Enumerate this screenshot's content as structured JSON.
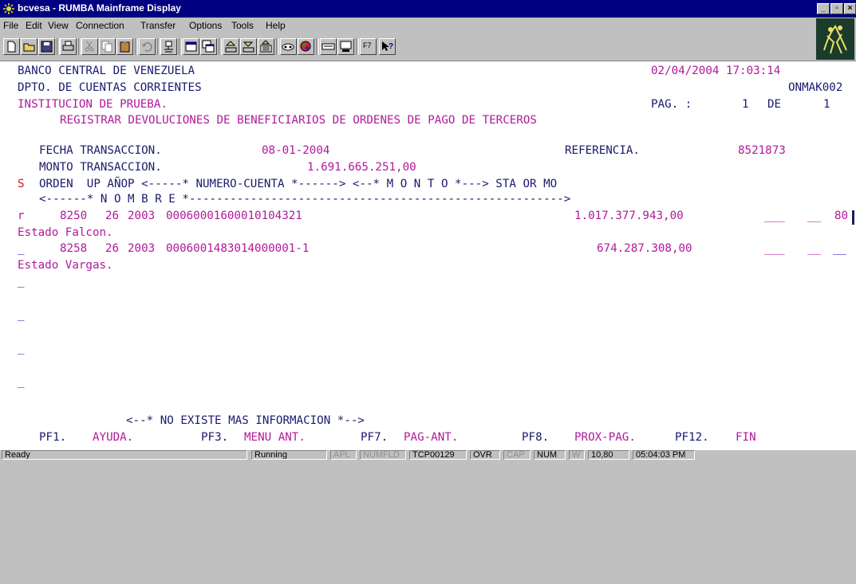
{
  "window": {
    "title": "bcvesa - RUMBA Mainframe Display",
    "controls": [
      "_",
      "▫",
      "×"
    ]
  },
  "menu": [
    "File",
    "Edit",
    "View",
    "Connection",
    "Transfer",
    "Options",
    "Tools",
    "Help"
  ],
  "toolbar": {
    "f7_label": "F7"
  },
  "screen": {
    "header": {
      "bank": "BANCO CENTRAL DE VENEZUELA",
      "datetime": "02/04/2004 17:03:14",
      "dept": "DPTO. DE CUENTAS CORRIENTES",
      "program": "ONMAK002",
      "institution": "INSTITUCION DE PRUEBA.",
      "page_label": "PAG. :",
      "page_num": "1",
      "page_of": "DE",
      "page_total": "1",
      "title": "REGISTRAR DEVOLUCIONES DE BENEFICIARIOS DE ORDENES DE PAGO DE TERCEROS"
    },
    "fields": {
      "fecha_label": "FECHA TRANSACCION.",
      "fecha_value": "08-01-2004",
      "ref_label": "REFERENCIA.",
      "ref_value": "8521873",
      "monto_label": "MONTO TRANSACCION.",
      "monto_value": "1.691.665.251,00"
    },
    "columns": {
      "sel": "S",
      "line1": "ORDEN  UP AÑOP <-----* NUMERO-CUENTA *------> <--* M O N T O *---> STA OR MO",
      "line2": "<------* N O M B R E *------------------------------------------------------->"
    },
    "rows": [
      {
        "sel": "r",
        "orden": "8250",
        "up": "26",
        "anop": "2003",
        "cuenta": "00060001600010104321",
        "monto": "1.017.377.943,00",
        "sta": "___",
        "or": "__",
        "mo": "80",
        "nombre": "Estado Falcon."
      },
      {
        "sel": "_",
        "orden": "8258",
        "up": "26",
        "anop": "2003",
        "cuenta": "0006001483014000001-1",
        "monto": "674.287.308,00",
        "sta": "___",
        "or": "__",
        "mo": "__",
        "nombre": "Estado Vargas."
      }
    ],
    "empty_selectors": [
      "_",
      "_",
      "_",
      "_"
    ],
    "no_more": "<--* NO EXISTE MAS INFORMACION *-->",
    "pfkeys": [
      {
        "key": "PF1.",
        "label": "AYUDA."
      },
      {
        "key": "PF3.",
        "label": "MENU ANT."
      },
      {
        "key": "PF7.",
        "label": "PAG-ANT."
      },
      {
        "key": "PF8.",
        "label": "PROX-PAG."
      },
      {
        "key": "PF12.",
        "label": "FIN"
      }
    ]
  },
  "status": {
    "ready": "Ready",
    "running": "Running",
    "apl": "APL",
    "numfld": "NUMFLD",
    "session": "TCP00129",
    "ovr": "OVR",
    "cap": "CAP",
    "num": "NUM",
    "w": "W",
    "cursor_pos": "10,80",
    "time": "05:04:03 PM"
  },
  "colors": {
    "titlebar": "#000080",
    "terminal_bg": "#ffffff",
    "navy_text": "#1a1a6e",
    "magenta_text": "#b01a9a",
    "red_text": "#d01818"
  }
}
